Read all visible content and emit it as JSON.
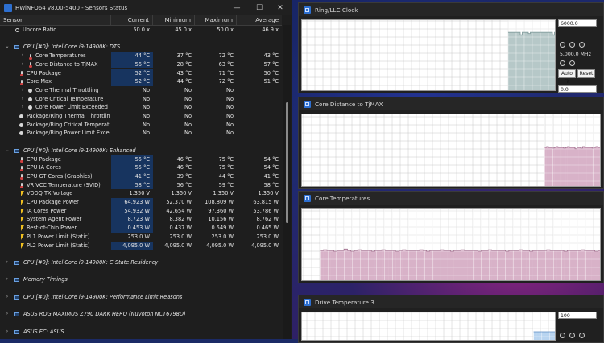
{
  "window": {
    "title": "HWiNFO64 v8.00-5400 - Sensors Status",
    "min_glyph": "—",
    "max_glyph": "☐",
    "close_glyph": "✕"
  },
  "columns": {
    "sensor": "Sensor",
    "current": "Current",
    "minimum": "Minimum",
    "maximum": "Maximum",
    "average": "Average"
  },
  "rows": [
    {
      "type": "item",
      "icon": "clock",
      "indent": 0,
      "name": "Uncore Ratio",
      "cur": "50.0 x",
      "min": "45.0 x",
      "max": "50.0 x",
      "avg": "46.9 x",
      "hl": false
    },
    {
      "type": "spacer"
    },
    {
      "type": "group",
      "expanded": true,
      "name": "CPU [#0]: Intel Core i9-14900K: DTS"
    },
    {
      "type": "item",
      "icon": "therm",
      "indent": 2,
      "chev": "›",
      "name": "Core Temperatures",
      "cur": "44 °C",
      "min": "37 °C",
      "max": "72 °C",
      "avg": "43 °C",
      "hl": true
    },
    {
      "type": "item",
      "icon": "therm",
      "indent": 2,
      "chev": "›",
      "name": "Core Distance to TjMAX",
      "cur": "56 °C",
      "min": "28 °C",
      "max": "63 °C",
      "avg": "57 °C",
      "hl": true
    },
    {
      "type": "item",
      "icon": "therm",
      "indent": 1,
      "name": "CPU Package",
      "cur": "52 °C",
      "min": "43 °C",
      "max": "71 °C",
      "avg": "50 °C",
      "hl": true
    },
    {
      "type": "item",
      "icon": "therm",
      "indent": 1,
      "name": "Core Max",
      "cur": "52 °C",
      "min": "44 °C",
      "max": "72 °C",
      "avg": "51 °C",
      "hl": true
    },
    {
      "type": "item",
      "icon": "circle",
      "indent": 2,
      "chev": "›",
      "name": "Core Thermal Throttling",
      "cur": "No",
      "min": "No",
      "max": "No",
      "avg": "",
      "hl": false
    },
    {
      "type": "item",
      "icon": "circle",
      "indent": 2,
      "chev": "›",
      "name": "Core Critical Temperature",
      "cur": "No",
      "min": "No",
      "max": "No",
      "avg": "",
      "hl": false
    },
    {
      "type": "item",
      "icon": "circle",
      "indent": 2,
      "chev": "›",
      "name": "Core Power Limit Exceeded",
      "cur": "No",
      "min": "No",
      "max": "No",
      "avg": "",
      "hl": false
    },
    {
      "type": "item",
      "icon": "circle",
      "indent": 1,
      "name": "Package/Ring Thermal Throttling",
      "cur": "No",
      "min": "No",
      "max": "No",
      "avg": "",
      "hl": false
    },
    {
      "type": "item",
      "icon": "circle",
      "indent": 1,
      "name": "Package/Ring Critical Temperature",
      "cur": "No",
      "min": "No",
      "max": "No",
      "avg": "",
      "hl": false
    },
    {
      "type": "item",
      "icon": "circle",
      "indent": 1,
      "name": "Package/Ring Power Limit Excee...",
      "cur": "No",
      "min": "No",
      "max": "No",
      "avg": "",
      "hl": false
    },
    {
      "type": "spacer"
    },
    {
      "type": "group",
      "expanded": true,
      "name": "CPU [#0]: Intel Core i9-14900K: Enhanced"
    },
    {
      "type": "item",
      "icon": "therm",
      "indent": 1,
      "name": "CPU Package",
      "cur": "55 °C",
      "min": "46 °C",
      "max": "75 °C",
      "avg": "54 °C",
      "hl": true
    },
    {
      "type": "item",
      "icon": "therm",
      "indent": 1,
      "name": "CPU IA Cores",
      "cur": "55 °C",
      "min": "46 °C",
      "max": "75 °C",
      "avg": "54 °C",
      "hl": true
    },
    {
      "type": "item",
      "icon": "therm",
      "indent": 1,
      "name": "CPU GT Cores (Graphics)",
      "cur": "41 °C",
      "min": "39 °C",
      "max": "44 °C",
      "avg": "41 °C",
      "hl": true
    },
    {
      "type": "item",
      "icon": "therm",
      "indent": 1,
      "name": "VR VCC Temperature (SVID)",
      "cur": "58 °C",
      "min": "56 °C",
      "max": "59 °C",
      "avg": "58 °C",
      "hl": true
    },
    {
      "type": "item",
      "icon": "bolt",
      "indent": 1,
      "name": "VDDQ TX Voltage",
      "cur": "1.350 V",
      "min": "1.350 V",
      "max": "1.350 V",
      "avg": "1.350 V",
      "hl": false
    },
    {
      "type": "item",
      "icon": "bolt",
      "indent": 1,
      "name": "CPU Package Power",
      "cur": "64.923 W",
      "min": "52.370 W",
      "max": "108.809 W",
      "avg": "63.815 W",
      "hl": true
    },
    {
      "type": "item",
      "icon": "bolt",
      "indent": 1,
      "name": "IA Cores Power",
      "cur": "54.932 W",
      "min": "42.654 W",
      "max": "97.360 W",
      "avg": "53.786 W",
      "hl": true
    },
    {
      "type": "item",
      "icon": "bolt",
      "indent": 1,
      "name": "System Agent Power",
      "cur": "8.723 W",
      "min": "8.382 W",
      "max": "10.156 W",
      "avg": "8.762 W",
      "hl": true
    },
    {
      "type": "item",
      "icon": "bolt",
      "indent": 1,
      "name": "Rest-of-Chip Power",
      "cur": "0.453 W",
      "min": "0.437 W",
      "max": "0.549 W",
      "avg": "0.465 W",
      "hl": true
    },
    {
      "type": "item",
      "icon": "bolt",
      "indent": 1,
      "name": "PL1 Power Limit (Static)",
      "cur": "253.0 W",
      "min": "253.0 W",
      "max": "253.0 W",
      "avg": "253.0 W",
      "hl": false
    },
    {
      "type": "item",
      "icon": "bolt",
      "indent": 1,
      "name": "PL2 Power Limit (Static)",
      "cur": "4,095.0 W",
      "min": "4,095.0 W",
      "max": "4,095.0 W",
      "avg": "4,095.0 W",
      "hl": true
    },
    {
      "type": "spacer"
    },
    {
      "type": "group",
      "expanded": false,
      "name": "CPU [#0]: Intel Core i9-14900K: C-State Residency"
    },
    {
      "type": "spacer"
    },
    {
      "type": "group",
      "expanded": false,
      "name": "Memory Timings"
    },
    {
      "type": "spacer"
    },
    {
      "type": "group",
      "expanded": false,
      "name": "CPU [#0]: Intel Core i9-14900K: Performance Limit Reasons"
    },
    {
      "type": "spacer"
    },
    {
      "type": "group",
      "expanded": false,
      "name": "ASUS ROG MAXIMUS Z790 DARK HERO (Nuvoton NCT6798D)"
    },
    {
      "type": "spacer"
    },
    {
      "type": "group",
      "expanded": false,
      "name": "ASUS EC: ASUS"
    }
  ],
  "graphs": {
    "ring": {
      "title": "Ring/LLC Clock",
      "max_field": "6000.0",
      "value_label": "5,000.0 MHz",
      "min_field": "0.0",
      "autofit_label": "Auto Fit",
      "reset_label": "Reset",
      "fill_color": "#b6c8c8",
      "series": [
        50,
        50,
        50,
        50,
        50,
        50,
        48,
        50,
        50,
        50,
        49,
        50,
        50,
        50,
        50,
        50,
        50,
        50,
        50,
        50,
        50,
        50,
        48,
        50
      ],
      "ymax": 60
    },
    "distance": {
      "title": "Core Distance to TjMAX",
      "fill_color": "#d8b2c8",
      "series": [
        56,
        57,
        56,
        56,
        55,
        56,
        57,
        56,
        56,
        56,
        55,
        56,
        57,
        56,
        56,
        56,
        54,
        56,
        56,
        55,
        57,
        56,
        56,
        56,
        56,
        55,
        56,
        57,
        56,
        56
      ],
      "ymax": 100
    },
    "temps": {
      "title": "Core Temperatures",
      "fill_color": "#d8b2c8",
      "series": [
        44,
        45,
        44,
        44,
        43,
        44,
        44,
        46,
        44,
        43,
        44,
        45,
        44,
        44,
        44,
        43,
        44,
        44,
        45,
        44,
        44,
        44,
        43,
        44,
        45,
        44,
        44,
        44,
        44,
        45,
        44,
        43,
        44,
        44,
        44,
        45,
        44,
        44,
        43,
        44,
        44,
        45,
        44,
        44,
        44,
        44,
        43,
        44,
        44,
        45,
        44,
        44,
        44,
        44,
        43,
        44,
        44,
        44,
        45,
        44,
        44,
        43,
        44,
        44,
        44,
        44,
        45,
        44,
        44,
        44,
        44,
        43,
        44,
        44,
        44,
        44,
        45,
        44,
        44,
        44,
        43,
        44
      ],
      "ymax": 100
    },
    "drive": {
      "title": "Drive Temperature 3",
      "max_field": "100",
      "fill_color": "#b8d4f0",
      "series": [
        40,
        40,
        40,
        40,
        40,
        40,
        40,
        40
      ],
      "ymax": 100
    }
  }
}
